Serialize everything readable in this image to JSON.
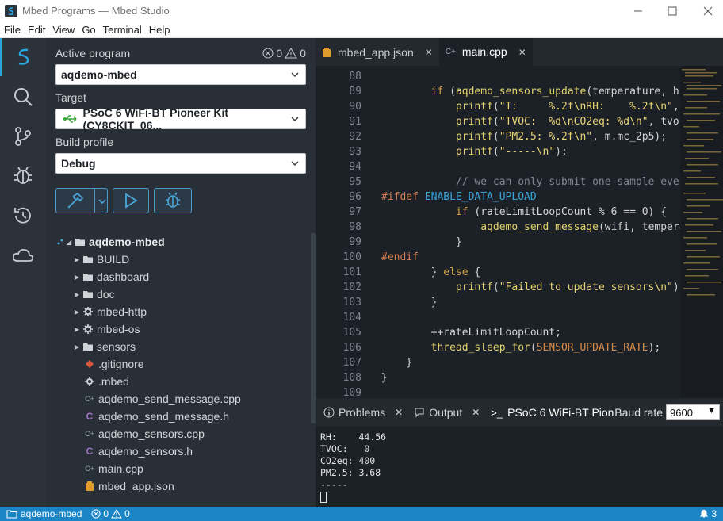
{
  "window": {
    "title": "Mbed Programs — Mbed Studio",
    "controls": [
      "minimize-icon",
      "maximize-icon",
      "close-icon"
    ]
  },
  "menu": [
    "File",
    "Edit",
    "View",
    "Go",
    "Terminal",
    "Help"
  ],
  "activity_bar": [
    "mbed-logo-icon",
    "search-icon",
    "source-control-icon",
    "debug-icon",
    "history-icon",
    "cloud-icon"
  ],
  "sidebar": {
    "active_program_label": "Active program",
    "problems_errors": "0",
    "problems_warnings": "0",
    "active_program": "aqdemo-mbed",
    "target_label": "Target",
    "target": "PSoC 6 WiFi-BT Pioneer Kit (CY8CKIT_06...",
    "build_profile_label": "Build profile",
    "build_profile": "Debug"
  },
  "tree": {
    "root": "aqdemo-mbed",
    "items": [
      {
        "label": "BUILD",
        "kind": "folder"
      },
      {
        "label": "dashboard",
        "kind": "folder"
      },
      {
        "label": "doc",
        "kind": "folder"
      },
      {
        "label": "mbed-http",
        "kind": "lib"
      },
      {
        "label": "mbed-os",
        "kind": "lib"
      },
      {
        "label": "sensors",
        "kind": "folder"
      },
      {
        "label": ".gitignore",
        "kind": "git"
      },
      {
        "label": ".mbed",
        "kind": "config"
      },
      {
        "label": "aqdemo_send_message.cpp",
        "kind": "cpp"
      },
      {
        "label": "aqdemo_send_message.h",
        "kind": "h"
      },
      {
        "label": "aqdemo_sensors.cpp",
        "kind": "cpp"
      },
      {
        "label": "aqdemo_sensors.h",
        "kind": "h"
      },
      {
        "label": "main.cpp",
        "kind": "cpp"
      },
      {
        "label": "mbed_app.json",
        "kind": "json"
      }
    ]
  },
  "editor": {
    "tabs": [
      {
        "label": "mbed_app.json"
      },
      {
        "label": "main.cpp"
      }
    ],
    "lines": [
      "88",
      "89",
      "90",
      "91",
      "92",
      "93",
      "94",
      "95",
      "96",
      "97",
      "98",
      "99",
      "100",
      "101",
      "102",
      "103",
      "104",
      "105",
      "106",
      "107",
      "108",
      "109"
    ]
  },
  "panel": {
    "tabs": [
      "Problems",
      "Output",
      "PSoC 6 WiFi-BT Pion"
    ],
    "baud_label": "Baud rate",
    "baud_value": "9600",
    "terminal": "RH:    44.56\nTVOC:   0\nCO2eq: 400\nPM2.5: 3.68\n-----"
  },
  "status": {
    "program": "aqdemo-mbed",
    "errors": "0",
    "warnings": "0",
    "notifications": "3"
  },
  "colors": {
    "accent": "#1b84c4",
    "button_border": "#4b9bc9",
    "keyword": "#d29e4b",
    "preprocessor": "#d97d52"
  }
}
